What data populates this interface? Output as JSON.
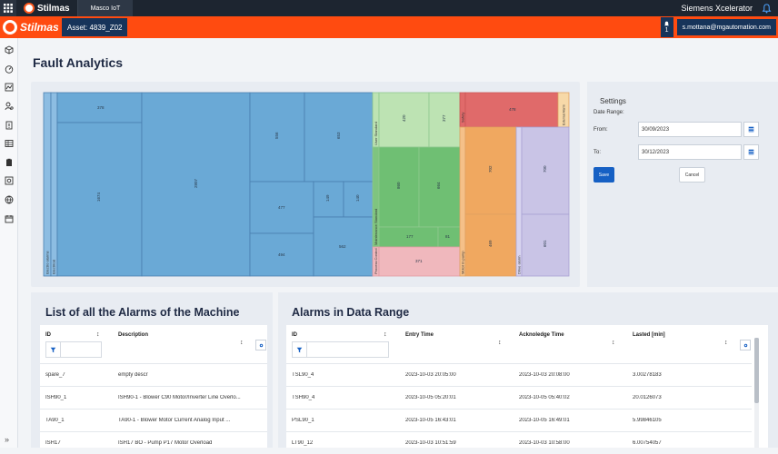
{
  "topbar": {
    "brand": "Stilmas",
    "tab": "Masco IoT",
    "product": "Siemens Xcelerator"
  },
  "assetbar": {
    "brand": "Stilmas",
    "asset": "Asset: 4839_Z02",
    "notification_count": "1",
    "user": "s.mottana@mgautomation.com"
  },
  "page": {
    "title": "Fault Analytics"
  },
  "treemap": {
    "labels": {
      "blue_a": "378",
      "blue_b": "1674",
      "blue_c": "2807",
      "blue_d": "556",
      "blue_e": "653",
      "blue_f": "477",
      "blue_g": "149",
      "blue_h": "140",
      "blue_i": "494",
      "blue_j": "562",
      "g_a": "420",
      "g_b": "377",
      "g_c": "860",
      "g_d": "664",
      "g_e": "177",
      "g_f": "81",
      "pink": "371",
      "red": "478",
      "orange_a": "702",
      "orange_b": "469",
      "lav_a": "700",
      "lav_b": "601"
    },
    "groups": {
      "electro_alarms": "Electro alarms",
      "electrical": "Electrical",
      "user_standard": "User Standard",
      "maintenance_standard": "Maintenance Standard",
      "process_control": "Process Control",
      "safety": "Safety",
      "motor_in_pump": "Motor in pump",
      "drive_alarm": "Drive alarm",
      "external_alarm": "External Alarm"
    }
  },
  "settings": {
    "title": "Settings",
    "date_range_label": "Date Range:",
    "from_label": "From:",
    "from_value": "30/09/2023",
    "to_label": "To:",
    "to_value": "30/12/2023",
    "save_label": "Save",
    "cancel_label": "Cancel"
  },
  "alarms_list": {
    "title": "List of all the Alarms of the Machine",
    "columns": {
      "id": "ID",
      "description": "Description"
    },
    "rows": [
      {
        "id": "spare_7",
        "description": "empty descr"
      },
      {
        "id": "ISH90_1",
        "description": "ISH90-1 - Blower C90 Motor/Inverter Line Overlo..."
      },
      {
        "id": "TA90_1",
        "description": "TA90-1 - Blower Motor Current Analog Input ..."
      },
      {
        "id": "ISH17",
        "description": "ISH17 BO - Pump P17 Motor Overload"
      }
    ]
  },
  "alarms_range": {
    "title": "Alarms in Data Range",
    "columns": {
      "id": "ID",
      "entry": "Entry Time",
      "ack": "Acknoledge Time",
      "lasted": "Lasted [min]"
    },
    "rows": [
      {
        "id": "TSL90_4",
        "entry": "2023-10-03 20:05:00",
        "ack": "2023-10-03 20:08:00",
        "lasted": "3.00278183"
      },
      {
        "id": "TSH90_4",
        "entry": "2023-10-05 05:20:01",
        "ack": "2023-10-05 05:40:02",
        "lasted": "20.0126073"
      },
      {
        "id": "PSL90_1",
        "entry": "2023-10-05 16:43:01",
        "ack": "2023-10-05 16:49:01",
        "lasted": "5.99846105"
      },
      {
        "id": "LT90_12",
        "entry": "2023-10-03 10:51:59",
        "ack": "2023-10-03 10:58:00",
        "lasted": "6.00754057"
      }
    ]
  },
  "colors": {
    "accent_orange": "#ff4b10",
    "navy": "#17345a",
    "primary_blue": "#1660c4",
    "treemap_blue": "#6aa9d6",
    "treemap_green": "#6fbf73",
    "treemap_lightgreen": "#bde3b3",
    "treemap_pink": "#f0b8bd",
    "treemap_red": "#e06a6a",
    "treemap_orange": "#f0a860",
    "treemap_lavender": "#c9c4e6"
  }
}
